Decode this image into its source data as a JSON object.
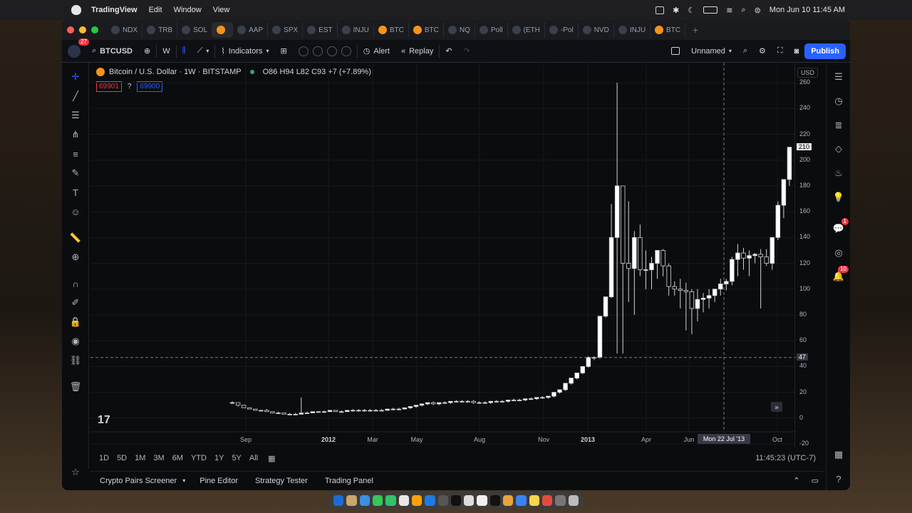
{
  "menubar": {
    "app": "TradingView",
    "items": [
      "Edit",
      "Window",
      "View"
    ],
    "clock": "Mon Jun 10  11:45 AM"
  },
  "tabs": [
    "NDX",
    "TRB",
    "SOL",
    "",
    "AAP",
    "SPX",
    "EST",
    "INJU",
    "BTC",
    "BTC",
    "NQ",
    "Poll",
    "(ETH",
    "-Pol",
    "NVD",
    "INJU",
    "BTC"
  ],
  "toolbar": {
    "notif_count": "27",
    "symbol": "BTCUSD",
    "interval": "W",
    "indicators": "Indicators",
    "alert": "Alert",
    "replay": "Replay",
    "layout_name": "Unnamed",
    "publish": "Publish"
  },
  "legend": {
    "title": "Bitcoin / U.S. Dollar · 1W · BITSTAMP",
    "ohlc": "O86 H94 L82 C93 +7 (+7.89%)",
    "bid": "69901",
    "qty": "?",
    "ask": "69900"
  },
  "price_axis": {
    "currency": "USD",
    "labels": [
      "260",
      "240",
      "220",
      "200",
      "180",
      "160",
      "140",
      "120",
      "100",
      "80",
      "60",
      "40",
      "20",
      "0",
      "-20"
    ],
    "last_price": "210",
    "crosshair_price": "47"
  },
  "time_axis": {
    "labels": [
      "Sep",
      "2012",
      "Mar",
      "May",
      "Aug",
      "Nov",
      "2013",
      "Apr",
      "Jun",
      "Oct"
    ],
    "crosshair_date": "Mon 22 Jul '13"
  },
  "ranges": [
    "1D",
    "5D",
    "1M",
    "3M",
    "6M",
    "YTD",
    "1Y",
    "5Y",
    "All"
  ],
  "clock_utc": "11:45:23 (UTC-7)",
  "panels": [
    "Crypto Pairs Screener",
    "Pine Editor",
    "Strategy Tester",
    "Trading Panel"
  ],
  "right_badges": {
    "chat": "1",
    "notifications": "10"
  },
  "chart_data": {
    "type": "candlestick",
    "title": "Bitcoin / U.S. Dollar · 1W · BITSTAMP",
    "ylim": [
      -20,
      270
    ],
    "candles": [
      [
        12,
        13,
        11,
        12
      ],
      [
        12,
        12,
        9,
        10
      ],
      [
        10,
        10,
        8,
        8
      ],
      [
        8,
        8,
        7,
        7
      ],
      [
        7,
        7,
        6,
        6
      ],
      [
        6,
        6,
        5,
        6
      ],
      [
        6,
        7,
        5,
        5
      ],
      [
        5,
        5,
        4,
        4
      ],
      [
        4,
        5,
        4,
        4
      ],
      [
        4,
        4,
        3,
        3
      ],
      [
        3,
        4,
        3,
        3
      ],
      [
        3,
        4,
        3,
        3
      ],
      [
        3,
        16,
        3,
        4
      ],
      [
        4,
        5,
        4,
        4
      ],
      [
        4,
        5,
        4,
        5
      ],
      [
        5,
        5,
        4,
        5
      ],
      [
        5,
        6,
        4,
        5
      ],
      [
        5,
        6,
        5,
        6
      ],
      [
        6,
        6,
        5,
        5
      ],
      [
        5,
        6,
        5,
        5
      ],
      [
        5,
        6,
        5,
        6
      ],
      [
        6,
        7,
        5,
        6
      ],
      [
        6,
        7,
        5,
        6
      ],
      [
        6,
        7,
        5,
        6
      ],
      [
        6,
        7,
        5,
        6
      ],
      [
        6,
        7,
        6,
        6
      ],
      [
        6,
        7,
        6,
        6
      ],
      [
        6,
        7,
        6,
        7
      ],
      [
        7,
        8,
        6,
        7
      ],
      [
        7,
        8,
        6,
        7
      ],
      [
        7,
        8,
        7,
        8
      ],
      [
        8,
        9,
        7,
        9
      ],
      [
        9,
        10,
        8,
        10
      ],
      [
        10,
        11,
        9,
        11
      ],
      [
        11,
        12,
        10,
        12
      ],
      [
        12,
        13,
        10,
        11
      ],
      [
        11,
        12,
        10,
        12
      ],
      [
        12,
        13,
        11,
        12
      ],
      [
        12,
        13,
        11,
        13
      ],
      [
        13,
        14,
        12,
        13
      ],
      [
        13,
        14,
        12,
        13
      ],
      [
        13,
        14,
        12,
        13
      ],
      [
        13,
        14,
        11,
        12
      ],
      [
        12,
        13,
        11,
        12
      ],
      [
        12,
        13,
        11,
        12
      ],
      [
        12,
        13,
        11,
        13
      ],
      [
        13,
        14,
        12,
        13
      ],
      [
        13,
        14,
        12,
        13
      ],
      [
        13,
        14,
        12,
        14
      ],
      [
        14,
        15,
        13,
        14
      ],
      [
        14,
        15,
        13,
        14
      ],
      [
        14,
        15,
        13,
        15
      ],
      [
        15,
        16,
        14,
        15
      ],
      [
        15,
        16,
        14,
        16
      ],
      [
        16,
        17,
        15,
        16
      ],
      [
        16,
        17,
        15,
        17
      ],
      [
        17,
        20,
        16,
        20
      ],
      [
        20,
        22,
        19,
        22
      ],
      [
        22,
        27,
        21,
        27
      ],
      [
        27,
        31,
        26,
        31
      ],
      [
        31,
        35,
        30,
        35
      ],
      [
        35,
        40,
        34,
        40
      ],
      [
        40,
        48,
        39,
        47
      ],
      [
        47,
        48,
        45,
        47
      ],
      [
        47,
        79,
        46,
        79
      ],
      [
        79,
        94,
        78,
        94
      ],
      [
        94,
        166,
        93,
        140
      ],
      [
        140,
        260,
        50,
        180
      ],
      [
        180,
        170,
        50,
        120
      ],
      [
        120,
        168,
        90,
        116
      ],
      [
        116,
        145,
        80,
        140
      ],
      [
        140,
        150,
        110,
        115
      ],
      [
        115,
        130,
        100,
        115
      ],
      [
        115,
        125,
        100,
        120
      ],
      [
        120,
        128,
        108,
        130
      ],
      [
        130,
        131,
        110,
        118
      ],
      [
        118,
        120,
        95,
        102
      ],
      [
        102,
        106,
        95,
        100
      ],
      [
        100,
        108,
        85,
        99
      ],
      [
        99,
        105,
        68,
        98
      ],
      [
        98,
        100,
        65,
        85
      ],
      [
        85,
        100,
        75,
        92
      ],
      [
        92,
        97,
        82,
        93
      ],
      [
        93,
        100,
        85,
        95
      ],
      [
        95,
        100,
        90,
        100
      ],
      [
        100,
        108,
        95,
        104
      ],
      [
        104,
        108,
        99,
        106
      ],
      [
        106,
        125,
        103,
        123
      ],
      [
        123,
        135,
        110,
        128
      ],
      [
        128,
        132,
        115,
        124
      ],
      [
        124,
        130,
        110,
        126
      ],
      [
        126,
        128,
        120,
        127
      ],
      [
        127,
        131,
        85,
        125
      ],
      [
        125,
        131,
        118,
        120
      ],
      [
        120,
        140,
        115,
        140
      ],
      [
        140,
        168,
        138,
        165
      ],
      [
        165,
        180,
        155,
        185
      ],
      [
        185,
        210,
        180,
        210
      ]
    ]
  }
}
